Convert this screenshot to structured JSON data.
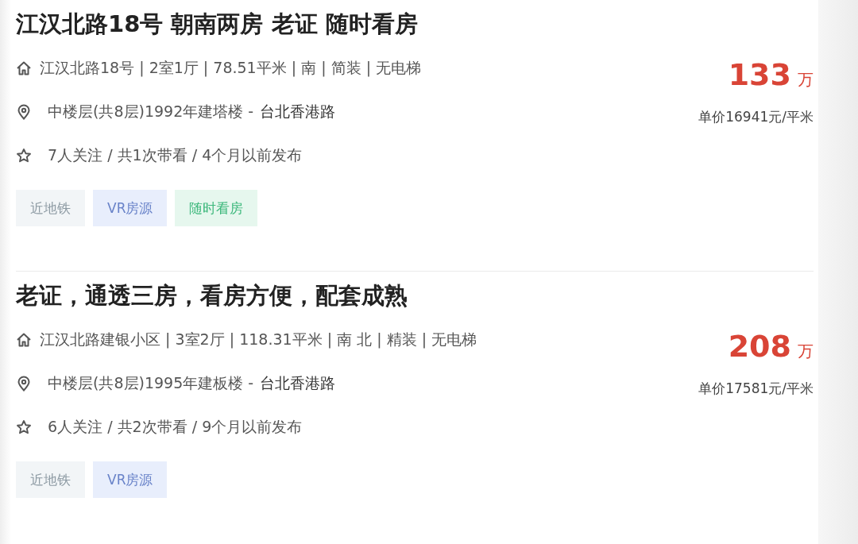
{
  "listings": [
    {
      "title": "江汉北路18号 朝南两房 老证 随时看房",
      "house_info": "江汉北路18号 | 2室1厅 | 78.51平米 | 南 | 简装 | 无电梯",
      "position_info": "中楼层(共8层)1992年建塔楼 -",
      "area": "台北香港路",
      "follow_info": "7人关注 / 共1次带看 / 4个月以前发布",
      "tags": [
        {
          "label": "近地铁",
          "kind": "subway"
        },
        {
          "label": "VR房源",
          "kind": "vr"
        },
        {
          "label": "随时看房",
          "kind": "anytime"
        }
      ],
      "price": "133",
      "price_unit": "万",
      "unit_price": "单价16941元/平米"
    },
    {
      "title": "老证，通透三房，看房方便，配套成熟",
      "house_info": "江汉北路建银小区 | 3室2厅 | 118.31平米 | 南 北 | 精装 | 无电梯",
      "position_info": "中楼层(共8层)1995年建板楼 -",
      "area": "台北香港路",
      "follow_info": "6人关注 / 共2次带看 / 9个月以前发布",
      "tags": [
        {
          "label": "近地铁",
          "kind": "subway"
        },
        {
          "label": "VR房源",
          "kind": "vr"
        }
      ],
      "price": "208",
      "price_unit": "万",
      "unit_price": "单价17581元/平米"
    }
  ]
}
